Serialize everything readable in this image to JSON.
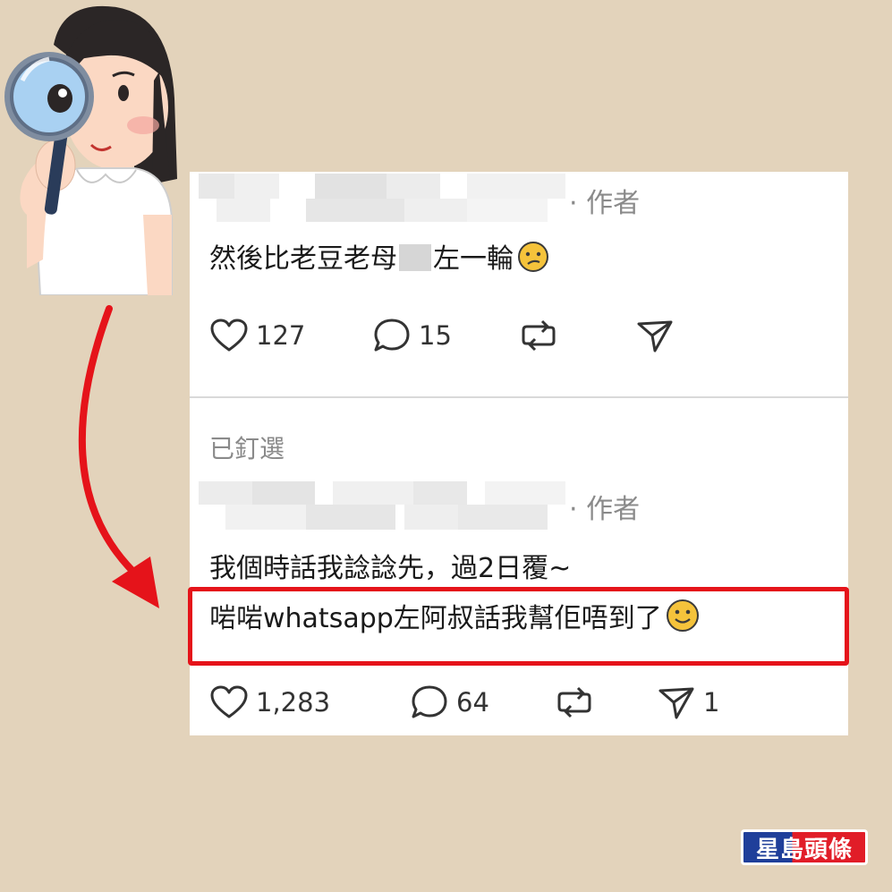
{
  "post1": {
    "author_tag": "· 作者",
    "text_before": "然後比老豆老母",
    "text_after": "左一輪",
    "emoji": "confused-face",
    "likes": "127",
    "comments": "15"
  },
  "pinned_label": "已釘選",
  "post2": {
    "author_tag": "· 作者",
    "line1": "我個時話我諗諗先，過2日覆~",
    "line2": "啱啱whatsapp左阿叔話我幫佢唔到了",
    "emoji": "slightly-smiling-face",
    "likes": "1,283",
    "comments": "64",
    "shares": "1"
  },
  "watermark": "星島頭條",
  "colors": {
    "background": "#e3d3bb",
    "highlight": "#e5131a",
    "arrow": "#e5131a",
    "logo_blue": "#1f3f9a",
    "logo_red": "#e11d28"
  }
}
